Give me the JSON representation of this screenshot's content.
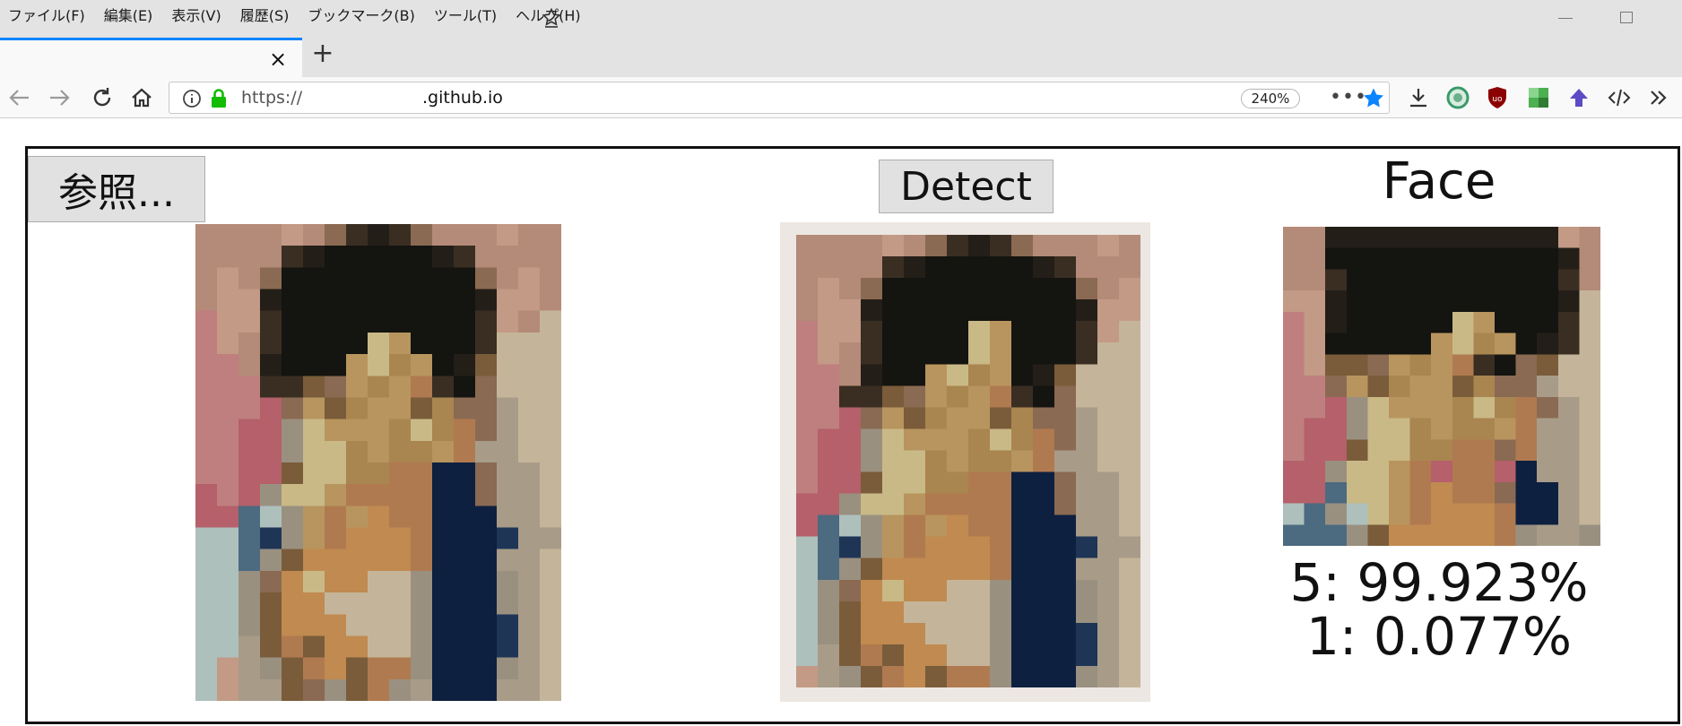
{
  "menu": {
    "items": [
      "ファイル(F)",
      "編集(E)",
      "表示(V)",
      "履歴(S)",
      "ブックマーク(B)",
      "ツール(T)",
      "ヘルプ(H)"
    ]
  },
  "tab": {
    "close_glyph": "×",
    "new_tab_glyph": "+"
  },
  "urlbar": {
    "scheme": "https://",
    "host": ".github.io",
    "zoom": "240%",
    "more": "•••"
  },
  "toolbar_icons": [
    "download-icon",
    "green-ring-extension-icon",
    "ublock-icon",
    "green-grid-extension-icon",
    "purple-arrow-extension-icon",
    "code-icon",
    "overflow-chevron-icon"
  ],
  "page": {
    "file_button_label": "参照...",
    "detect_button_label": "Detect",
    "face_title": "Face",
    "results": [
      "5: 99.923%",
      "1: 0.077%"
    ]
  },
  "colors": {
    "tab_accent": "#0a84ff",
    "bookmark_star": "#0a84ff",
    "lock_green": "#12bc00"
  }
}
